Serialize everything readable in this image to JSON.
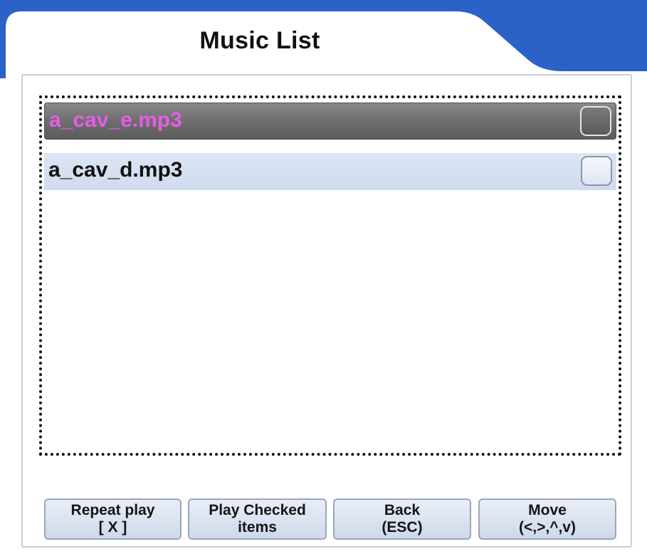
{
  "header": {
    "title": "Music List"
  },
  "list": {
    "items": [
      {
        "filename": "a_cav_e.mp3",
        "selected": true,
        "checked": false
      },
      {
        "filename": "a_cav_d.mp3",
        "selected": false,
        "checked": false
      }
    ]
  },
  "buttons": {
    "repeat_play": {
      "line1": "Repeat play",
      "line2": "[ X ]"
    },
    "play_checked": {
      "line1": "Play Checked",
      "line2": "items"
    },
    "back": {
      "line1": "Back",
      "line2": "(ESC)"
    },
    "move": {
      "line1": "Move",
      "line2": "(<,>,^,v)"
    }
  },
  "colors": {
    "frame_blue": "#2a62c8",
    "selected_text": "#e65ce6",
    "row_highlight": "#d0dbee",
    "button_bg": "#dbe3f1"
  }
}
